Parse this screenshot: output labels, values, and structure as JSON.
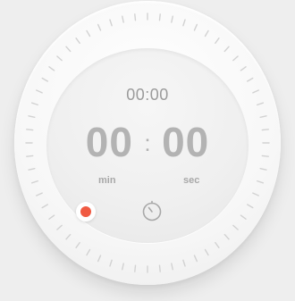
{
  "timer": {
    "small_display": "00:00",
    "minutes": "00",
    "separator": ":",
    "seconds": "00",
    "min_label": "min",
    "sec_label": "sec"
  },
  "icons": {
    "record": "record-icon",
    "timer": "stopwatch-icon"
  },
  "colors": {
    "record": "#f05a42",
    "text_primary": "#b3b3b3",
    "text_secondary": "#9b9b9b"
  }
}
